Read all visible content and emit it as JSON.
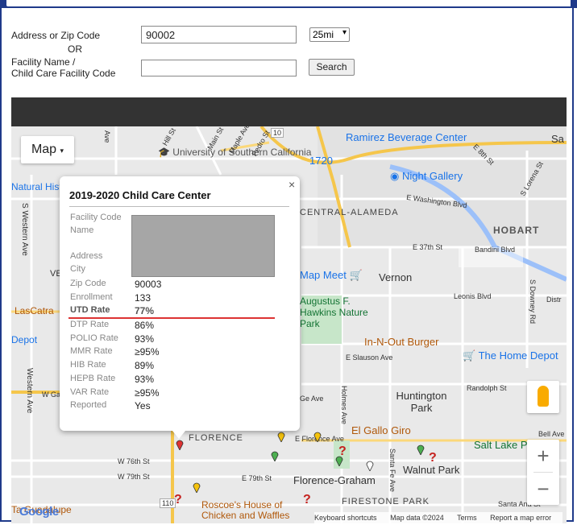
{
  "form": {
    "address_label": "Address or Zip Code",
    "address_value": "90002",
    "radius_value": "25mi",
    "or_label": "OR",
    "facility_label_line1": "Facility Name /",
    "facility_label_line2": "Child Care Facility Code",
    "facility_value": "",
    "search_label": "Search"
  },
  "map": {
    "map_type_label": "Map",
    "places": [
      {
        "name": "University of Southern California",
        "kind": "school-icon"
      },
      {
        "name": "Ramirez Beverage Center",
        "kind": "shopping-icon"
      },
      {
        "name": "1720",
        "kind": "music-icon"
      },
      {
        "name": "Night Gallery",
        "kind": "gallery-icon"
      },
      {
        "name": "Natural History Museum of Los Angeles",
        "kind": "museum-icon"
      },
      {
        "name": "HOBART",
        "kind": "area"
      },
      {
        "name": "Vernon",
        "kind": "city"
      },
      {
        "name": "Map Meet",
        "kind": "shopping-icon"
      },
      {
        "name": "Augustus F. Hawkins Nature Park",
        "kind": "park-icon"
      },
      {
        "name": "In-N-Out Burger",
        "kind": "restaurant-icon"
      },
      {
        "name": "The Home Depot",
        "kind": "shopping-icon"
      },
      {
        "name": "Huntington Park",
        "kind": "city"
      },
      {
        "name": "El Gallo Giro",
        "kind": "restaurant-icon"
      },
      {
        "name": "Salt Lake P",
        "kind": "park-icon"
      },
      {
        "name": "FLORENCE",
        "kind": "area"
      },
      {
        "name": "Florence-Graham",
        "kind": "city"
      },
      {
        "name": "Walnut Park",
        "kind": "city"
      },
      {
        "name": "FIRESTONE PARK",
        "kind": "area"
      },
      {
        "name": "Roscoe's House of Chicken and Waffles",
        "kind": "restaurant-icon"
      },
      {
        "name": "LasCatra",
        "kind": "place"
      },
      {
        "name": "Depot",
        "kind": "shopping-icon"
      },
      {
        "name": "Ta Guadalupe",
        "kind": "restaurant-icon"
      },
      {
        "name": "CENTRAL-ALAMEDA",
        "kind": "area"
      }
    ],
    "streets": [
      "S Western Ave",
      "Western Ave",
      "E Washington Blvd",
      "E 37th St",
      "Bandini Blvd",
      "Leonis Blvd",
      "Randolph St",
      "E Slauson Ave",
      "Holmes Ave",
      "Santa Fe Ave",
      "W 76th St",
      "W 79th St",
      "E 79th St",
      "E Florence Ave",
      "Bell Ave",
      "Santa Ana St",
      "S Downey Rd",
      "Maple Ave",
      "Main St",
      "Pedro St",
      "Hill St",
      "Ave",
      "E 8th St",
      "S Lorena St",
      "Distr",
      "Sa",
      "W Ga",
      "Ge Ave",
      "VE",
      "110",
      "10"
    ],
    "attribution": {
      "google": "Google",
      "shortcuts": "Keyboard shortcuts",
      "mapdata": "Map data ©2024",
      "terms": "Terms",
      "report": "Report a map error"
    }
  },
  "popup": {
    "title": "2019-2020 Child Care Center",
    "close": "×",
    "rows": [
      {
        "label": "Facility Code",
        "value": ""
      },
      {
        "label": "Name",
        "value": ""
      },
      {
        "label": "Address",
        "value": ""
      },
      {
        "label": "City",
        "value": ""
      },
      {
        "label": "Zip Code",
        "value": "90003"
      },
      {
        "label": "Enrollment",
        "value": "133"
      },
      {
        "label": "UTD Rate",
        "value": "77%"
      },
      {
        "label": "DTP Rate",
        "value": "86%"
      },
      {
        "label": "POLIO Rate",
        "value": "93%"
      },
      {
        "label": "MMR Rate",
        "value": "≥95%"
      },
      {
        "label": "HIB Rate",
        "value": "89%"
      },
      {
        "label": "HEPB Rate",
        "value": "93%"
      },
      {
        "label": "VAR Rate",
        "value": "≥95%"
      },
      {
        "label": "Reported",
        "value": "Yes"
      }
    ]
  },
  "colors": {
    "frame": "#1f3a8a",
    "red_underline": "#dd3333",
    "redacted": "#a6a6a6"
  }
}
